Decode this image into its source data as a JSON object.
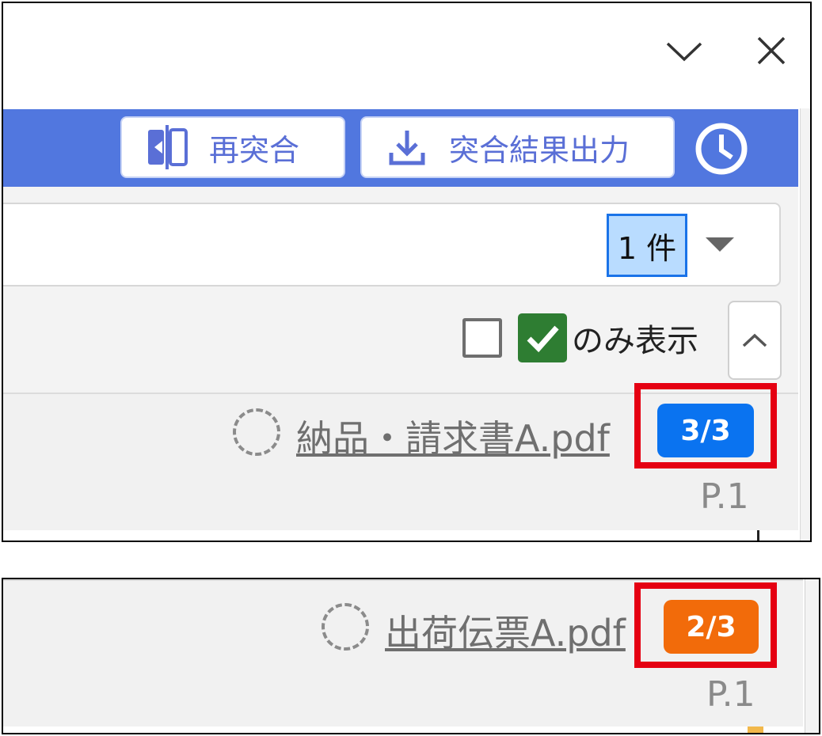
{
  "window": {
    "chevron_icon": "chevron-down-icon",
    "close_icon": "close-icon"
  },
  "toolbar": {
    "background": "#5177df",
    "rematch_label": "再突合",
    "rematch_icon": "compare-icon",
    "export_label": "突合結果出力",
    "export_icon": "download-icon",
    "history_icon": "clock-icon"
  },
  "count_selector": {
    "value": "1 件",
    "dropdown_icon": "caret-down-icon"
  },
  "filter": {
    "unchecked_box": false,
    "checked_box": true,
    "label": "のみ表示",
    "collapse_icon": "chevron-up-icon"
  },
  "files": [
    {
      "name": "納品・請求書A.pdf",
      "badge": "3/3",
      "badge_color": "#0a73f0",
      "page": "P.1",
      "highlighted": true
    },
    {
      "name": "出荷伝票A.pdf",
      "badge": "2/3",
      "badge_color": "#f26b0a",
      "page": "P.1",
      "highlighted": true
    }
  ],
  "highlight_color": "#e50012"
}
